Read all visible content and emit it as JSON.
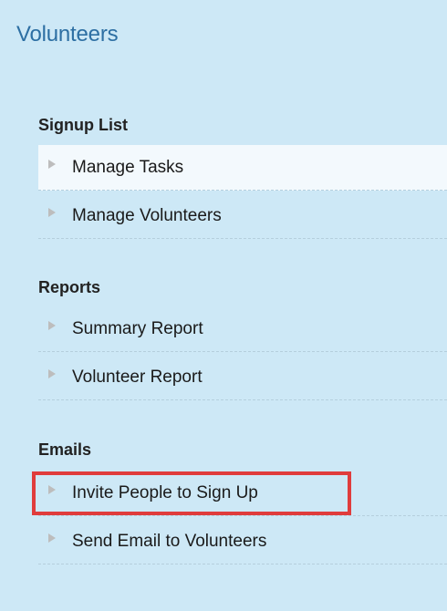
{
  "panel": {
    "title": "Volunteers",
    "sections": [
      {
        "heading": "Signup List",
        "items": [
          {
            "label": "Manage Tasks",
            "active": true
          },
          {
            "label": "Manage Volunteers"
          }
        ]
      },
      {
        "heading": "Reports",
        "items": [
          {
            "label": "Summary Report"
          },
          {
            "label": "Volunteer Report"
          }
        ]
      },
      {
        "heading": "Emails",
        "items": [
          {
            "label": "Invite People to Sign Up",
            "highlighted": true
          },
          {
            "label": "Send Email to Volunteers"
          }
        ]
      }
    ]
  },
  "icons": {
    "bullet": "triangle-right-icon"
  },
  "colors": {
    "panel_background": "#cde8f6",
    "title": "#2d6fa3",
    "active_item_background": "#f3f9fd",
    "highlight_border": "#e03c3c",
    "bullet": "#bdbdbd"
  }
}
